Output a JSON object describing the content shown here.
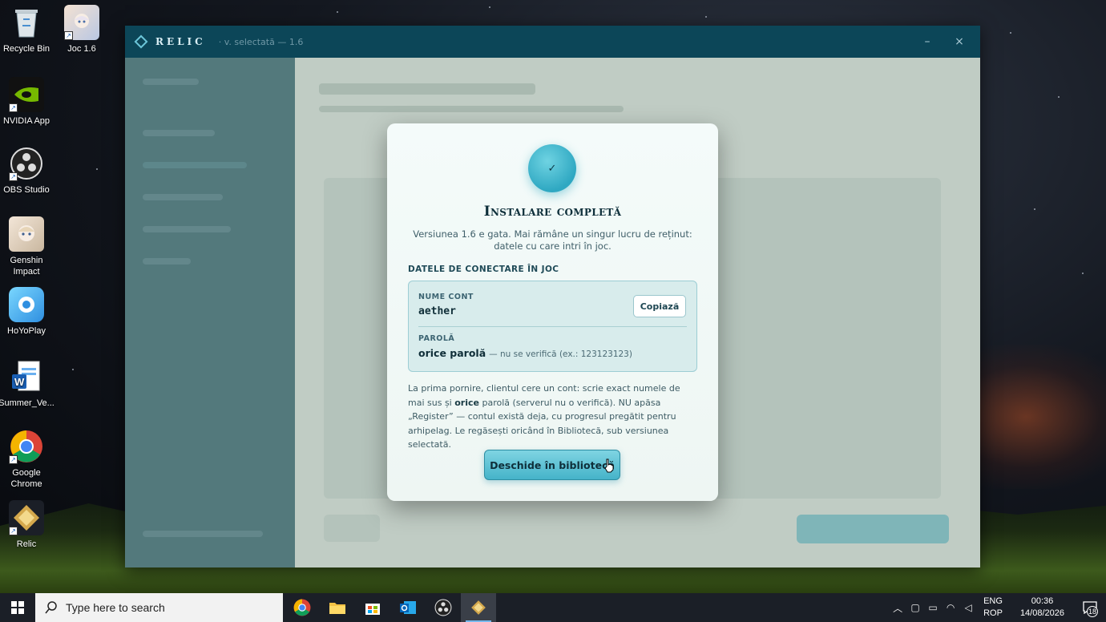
{
  "desktop": {
    "icons": [
      {
        "label": "Recycle Bin",
        "icon": "recycle-bin-icon"
      },
      {
        "label": "Joc 1.6",
        "icon": "game-shortcut-icon"
      },
      {
        "label": "NVIDIA App",
        "icon": "nvidia-icon"
      },
      {
        "label": "OBS Studio",
        "icon": "obs-icon"
      },
      {
        "label": "Genshin Impact",
        "icon": "genshin-icon"
      },
      {
        "label": "HoYoPlay",
        "icon": "hoyoplay-icon"
      },
      {
        "label": "Summer_Ve...",
        "icon": "word-doc-icon"
      },
      {
        "label": "Google Chrome",
        "icon": "chrome-icon"
      },
      {
        "label": "Relic",
        "icon": "relic-icon"
      }
    ]
  },
  "app": {
    "name": "RELIC",
    "version": "· v. selectată — 1.6",
    "minimize_glyph": "–",
    "close_glyph": "×"
  },
  "modal": {
    "check_glyph": "✓",
    "title": "Instalare completă",
    "subtitle": "Versiunea 1.6 e gata. Mai rămâne un singur lucru de reținut: datele cu care intri în joc.",
    "section_label": "DATELE DE CONECTARE ÎN JOC",
    "account_label": "NUME CONT",
    "account_value": "aether",
    "copy_label": "Copiază",
    "password_label": "PAROLĂ",
    "password_value": "orice parolă",
    "password_note": "— nu se verifică (ex.: 123123123)",
    "info_part1": "La prima pornire, clientul cere un cont: scrie exact numele de mai sus și ",
    "info_bold": "orice",
    "info_part2": " parolă (serverul nu o verifică). NU apăsa „Register” — contul există deja, cu progresul pregătit pentru arhipelag. Le regăsești oricând în Bibliotecă, sub versiunea selectată.",
    "primary_button": "Deschide în bibliotecă"
  },
  "taskbar": {
    "search_placeholder": "Type here to search",
    "apps": [
      "chrome-icon",
      "file-explorer-icon",
      "store-icon",
      "outlook-icon",
      "obs-icon",
      "relic-icon"
    ],
    "language_line1": "ENG",
    "language_line2": "ROP",
    "time": "00:36",
    "date": "14/08/2026",
    "notification_count": "18"
  },
  "colors": {
    "accent": "#45b3c9",
    "titlebar": "#0c4658",
    "sidebar": "#1c5060"
  }
}
